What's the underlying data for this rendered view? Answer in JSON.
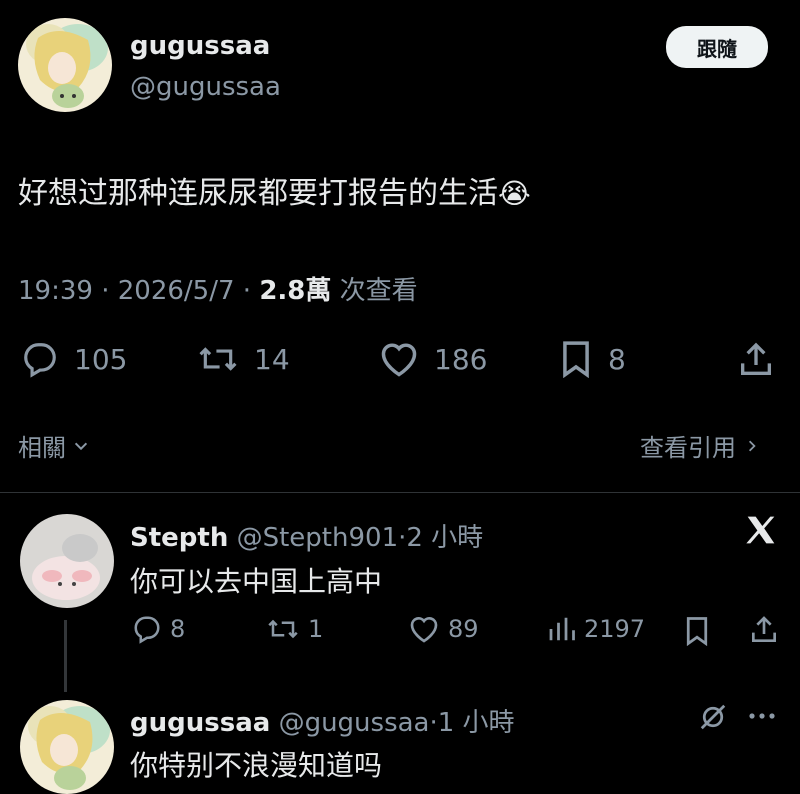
{
  "post": {
    "display_name": "gugussaa",
    "handle": "@gugussaa",
    "follow_label": "跟隨",
    "text": "好想过那种连尿尿都要打报告的生活",
    "emoji": "😭",
    "time": "19:39",
    "sep1": "·",
    "date": "2026/5/7",
    "sep2": "·",
    "views_count": "2.8萬",
    "views_label": "次查看",
    "stats": {
      "replies": "105",
      "reposts": "14",
      "likes": "186",
      "bookmarks": "8"
    },
    "related_label": "相關",
    "quotes_label": "查看引用"
  },
  "reply": {
    "display_name": "Stepth",
    "handle": "@Stepth901",
    "sep": "·",
    "time": "2 小時",
    "text": "你可以去中国上高中",
    "stats": {
      "replies": "8",
      "reposts": "1",
      "likes": "89",
      "views": "2197"
    }
  },
  "reply2": {
    "display_name": "gugussaa",
    "handle": "@gugussaa",
    "sep": "·",
    "time": "1 小時",
    "text": "你特别不浪漫知道吗"
  },
  "icons": {
    "reply": "comment-icon",
    "repost": "repost-icon",
    "like": "heart-icon",
    "bookmark": "bookmark-icon",
    "share": "share-icon",
    "views": "analytics-icon",
    "x_logo": "x-logo-icon",
    "grok": "grok-icon",
    "more": "more-icon"
  },
  "colors": {
    "background": "#000000",
    "text": "#e7e9ea",
    "muted": "#8b98a5",
    "follow_bg": "#eff3f4"
  }
}
